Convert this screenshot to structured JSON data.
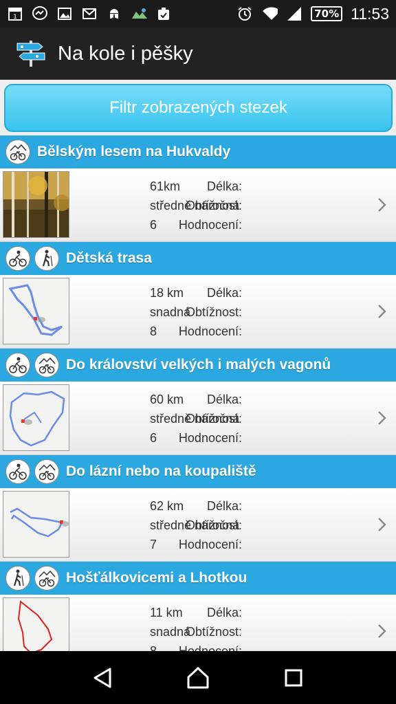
{
  "status": {
    "battery": "70%",
    "time": "11:53"
  },
  "app": {
    "title": "Na kole i pěšky"
  },
  "filter": {
    "label": "Filtr zobrazených stezek"
  },
  "labels": {
    "length": "Délka:",
    "difficulty": "Obtížnost:",
    "rating": "Hodnocení:"
  },
  "trails": [
    {
      "name": "Bělským lesem na Hukvaldy",
      "icons": [
        "mtb"
      ],
      "length": "61km",
      "difficulty": "středně náročná",
      "rating": "6"
    },
    {
      "name": "Dětská trasa",
      "icons": [
        "bike",
        "hike"
      ],
      "length": "18 km",
      "difficulty": "snadná",
      "rating": "8"
    },
    {
      "name": "Do království velkých i malých vagonů",
      "icons": [
        "bike",
        "mtb"
      ],
      "length": "60 km",
      "difficulty": "středně náročná",
      "rating": "6"
    },
    {
      "name": "Do lázní nebo na koupaliště",
      "icons": [
        "bike",
        "mtb"
      ],
      "length": "62 km",
      "difficulty": "středně náročná",
      "rating": "7"
    },
    {
      "name": "Hošťálkovicemi a Lhotkou",
      "icons": [
        "hike",
        "mtb"
      ],
      "length": "11 km",
      "difficulty": "snadná",
      "rating": "8"
    }
  ]
}
